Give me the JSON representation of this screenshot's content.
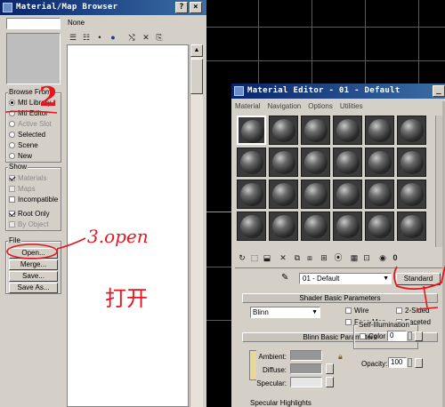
{
  "browser": {
    "title": "Material/Map Browser",
    "name_value": "None",
    "browse_from": {
      "label": "Browse From:",
      "options": [
        {
          "label": "Mtl Library",
          "selected": true,
          "enabled": true
        },
        {
          "label": "Mtl Editor",
          "selected": false,
          "enabled": true
        },
        {
          "label": "Active Slot",
          "selected": false,
          "enabled": false
        },
        {
          "label": "Selected",
          "selected": false,
          "enabled": true
        },
        {
          "label": "Scene",
          "selected": false,
          "enabled": true
        },
        {
          "label": "New",
          "selected": false,
          "enabled": true
        }
      ]
    },
    "show": {
      "label": "Show",
      "options": [
        {
          "label": "Materials",
          "checked": true,
          "enabled": false
        },
        {
          "label": "Maps",
          "checked": false,
          "enabled": false
        },
        {
          "label": "Incompatible",
          "checked": false,
          "enabled": true
        }
      ],
      "root_only": "Root Only",
      "by_object": "By Object"
    },
    "file": {
      "label": "File",
      "buttons": [
        "Open...",
        "Merge...",
        "Save...",
        "Save As..."
      ]
    }
  },
  "editor": {
    "title": "Material Editor - 01 - Default",
    "menu": [
      "Material",
      "Navigation",
      "Options",
      "Utilities"
    ],
    "material_name": "01 - Default",
    "type_button": "Standard",
    "shader_rollout": "Shader Basic Parameters",
    "shader_type": "Blinn",
    "shader_options": [
      {
        "label": "Wire",
        "checked": false
      },
      {
        "label": "2-Sided",
        "checked": false
      },
      {
        "label": "Face Map",
        "checked": false
      },
      {
        "label": "Faceted",
        "checked": false
      }
    ],
    "blinn_rollout": "Blinn Basic Parameters",
    "self_illum_label": "Self-Illumination",
    "color_label": "Color",
    "color_value": "0",
    "ambient_label": "Ambient:",
    "diffuse_label": "Diffuse:",
    "specular_label": "Specular:",
    "opacity_label": "Opacity:",
    "opacity_value": "100",
    "specular_highlights": "Specular Highlights"
  },
  "annotations": {
    "step2": "2",
    "step3": "3.open",
    "chinese": "打开"
  },
  "colors": {
    "annotation": "#e8141e",
    "titlebar": "#0a246a",
    "panel": "#d4d0c8"
  }
}
